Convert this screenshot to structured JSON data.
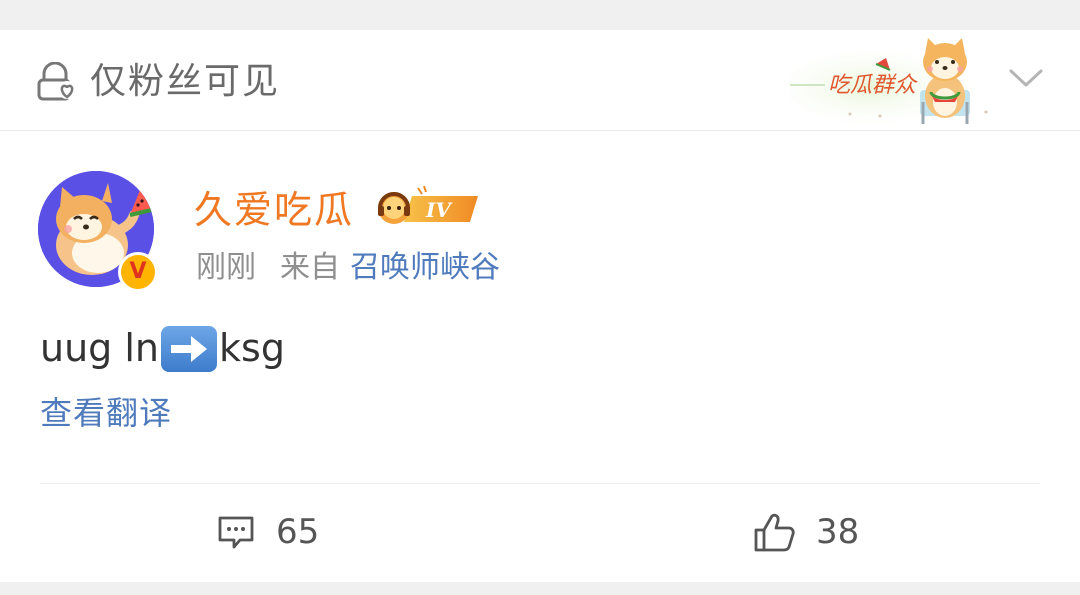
{
  "privacy": {
    "label": "仅粉丝可见",
    "icon": "lock-user-icon"
  },
  "header_sticker": {
    "text": "吃瓜群众",
    "icon": "shiba-sticker"
  },
  "collapse_icon": "chevron-down-icon",
  "post": {
    "author": {
      "name": "久爱吃瓜",
      "avatar": "shiba-watermelon-avatar",
      "verified_icon": "verified-v-badge",
      "verified_mark": "V",
      "level_badge": "IV"
    },
    "time": "刚刚",
    "source_prefix": "来自",
    "source_name": "召唤师峡谷",
    "text_before": "uug ln",
    "emoji": "right-arrow-emoji",
    "text_after": "ksg",
    "translate_label": "查看翻译"
  },
  "actions": {
    "comments": {
      "icon": "comment-icon",
      "count": "65"
    },
    "likes": {
      "icon": "thumbs-up-icon",
      "count": "38"
    }
  },
  "colors": {
    "username": "#f07823",
    "link": "#4f7bbd",
    "muted": "#8f8f8f",
    "avatar_bg": "#5b50e6"
  }
}
